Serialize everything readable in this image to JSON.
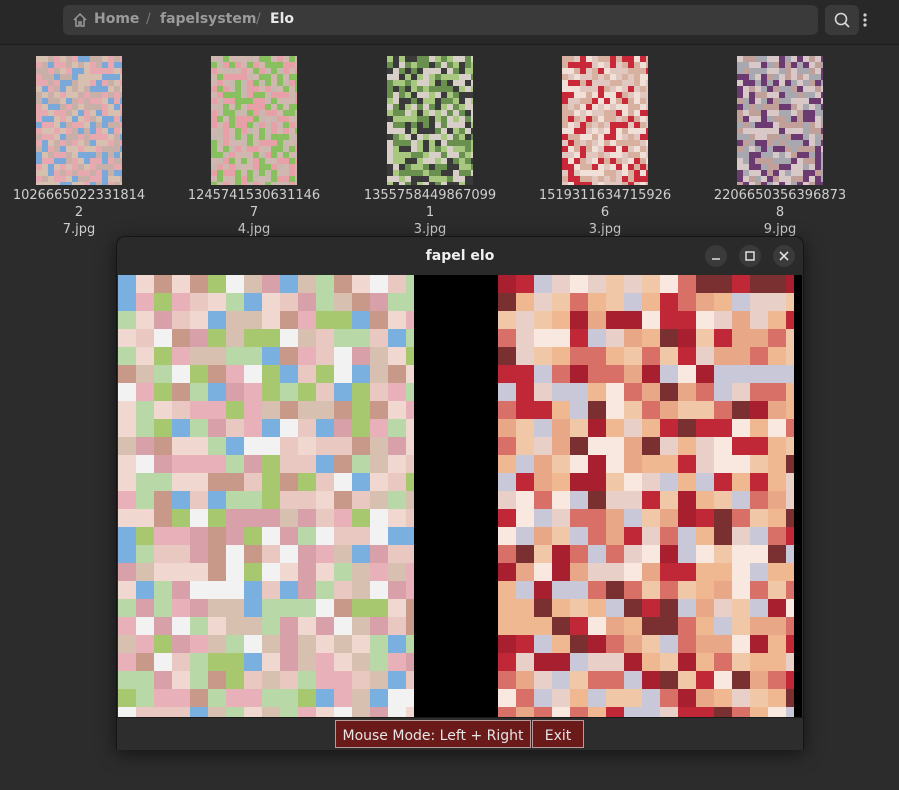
{
  "breadcrumb": {
    "home": "Home",
    "folder": "fapelsystem",
    "current": "Elo",
    "separator": "/"
  },
  "icons": {
    "home": "home-icon",
    "menu": "vertical-dots-icon",
    "search": "search-icon",
    "minimize": "minimize-icon",
    "maximize": "maximize-icon",
    "close": "close-icon"
  },
  "files": [
    {
      "name_line1": "10266650223318142",
      "name_line2": "7.jpg",
      "palette": [
        "#c8b0a8",
        "#e8a8b0",
        "#7aa8d8",
        "#d8c0b0"
      ]
    },
    {
      "name_line1": "12457415306311467",
      "name_line2": "4.jpg",
      "palette": [
        "#d0b8b0",
        "#e8a0a8",
        "#88c060",
        "#c8b8b0"
      ]
    },
    {
      "name_line1": "13557584498670991",
      "name_line2": "3.jpg",
      "palette": [
        "#6a9050",
        "#a8c880",
        "#3a3a3a",
        "#d8d0c8"
      ]
    },
    {
      "name_line1": "15193116347159266",
      "name_line2": "3.jpg",
      "palette": [
        "#e0c8c0",
        "#c82838",
        "#d8b0a0",
        "#f0e0d8"
      ]
    },
    {
      "name_line1": "22066503563968738",
      "name_line2": "9.jpg",
      "palette": [
        "#a8a8b0",
        "#6a3a70",
        "#c0a098",
        "#d8c8c8"
      ]
    }
  ],
  "dialog": {
    "title": "fapel elo",
    "mouse_mode_label": "Mouse Mode: Left + Right",
    "exit_label": "Exit"
  },
  "colors": {
    "button_bg": "#6b1a1a",
    "background": "#2c2c2c"
  }
}
